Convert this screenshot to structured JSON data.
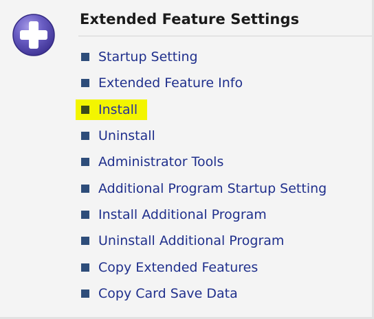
{
  "panel": {
    "title": "Extended Feature Settings",
    "icon": "plus-circle-icon",
    "icon_color": "#5a4fb3",
    "bullet_color": "#2e4d7a",
    "link_color": "#1f2f8c",
    "highlight_color": "#f3f500"
  },
  "menu": {
    "items": [
      {
        "label": "Startup Setting",
        "highlighted": false
      },
      {
        "label": "Extended Feature Info",
        "highlighted": false
      },
      {
        "label": "Install",
        "highlighted": true
      },
      {
        "label": "Uninstall",
        "highlighted": false
      },
      {
        "label": "Administrator Tools",
        "highlighted": false
      },
      {
        "label": "Additional Program Startup Setting",
        "highlighted": false
      },
      {
        "label": "Install Additional Program",
        "highlighted": false
      },
      {
        "label": "Uninstall Additional Program",
        "highlighted": false
      },
      {
        "label": "Copy Extended Features",
        "highlighted": false
      },
      {
        "label": "Copy Card Save Data",
        "highlighted": false
      }
    ]
  }
}
